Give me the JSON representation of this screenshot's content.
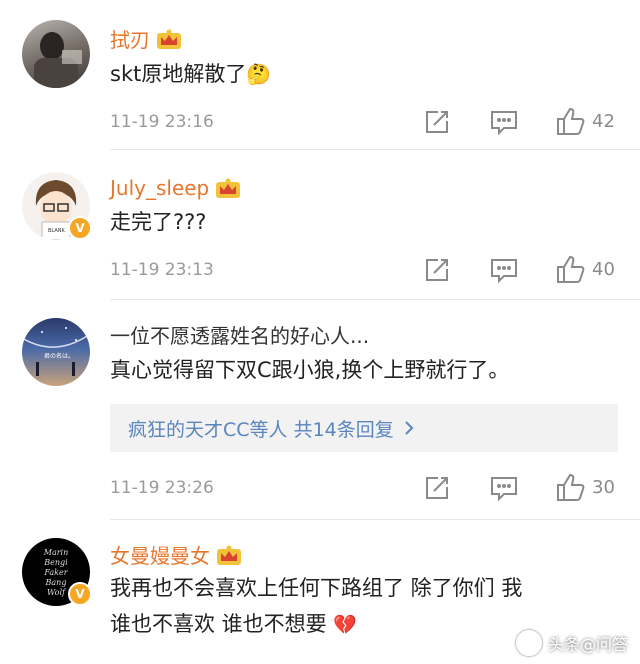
{
  "comments": [
    {
      "username": "拭刃",
      "text": "skt原地解散了",
      "emoji": "🤔",
      "timestamp": "11-19 23:16",
      "likes": "42",
      "verified": false
    },
    {
      "username": "July_sleep",
      "text": "走完了???",
      "timestamp": "11-19 23:13",
      "likes": "40",
      "verified": true
    },
    {
      "username": "一位不愿透露姓名的好心人...",
      "text": "真心觉得留下双C跟小狼,换个上野就行了。",
      "replies_summary": "疯狂的天才CC等人 共14条回复",
      "timestamp": "11-19 23:26",
      "likes": "30",
      "verified": false
    },
    {
      "username": "女曼嫚曼女",
      "text_line1": "我再也不会喜欢上任何下路组了 除了你们 我",
      "text_line2": "谁也不喜欢 谁也不想要",
      "emoji": "💔",
      "verified": true
    }
  ],
  "avatar_text": {
    "july": "BLANK",
    "film": "君の名は。",
    "black": [
      "Marin",
      "Bengi",
      "Faker",
      "Bang",
      "Wolf"
    ]
  },
  "icons": {
    "share": "share-icon",
    "comment": "comment-icon",
    "like": "thumbs-up-icon",
    "crown": "crown-badge-icon",
    "verified": "verified-v-icon"
  },
  "watermark": "头条@问答",
  "colors": {
    "username": "#e8772e",
    "reply_link": "#5a86bd",
    "meta": "#9a9a9a",
    "verified_badge": "#f5a623"
  }
}
